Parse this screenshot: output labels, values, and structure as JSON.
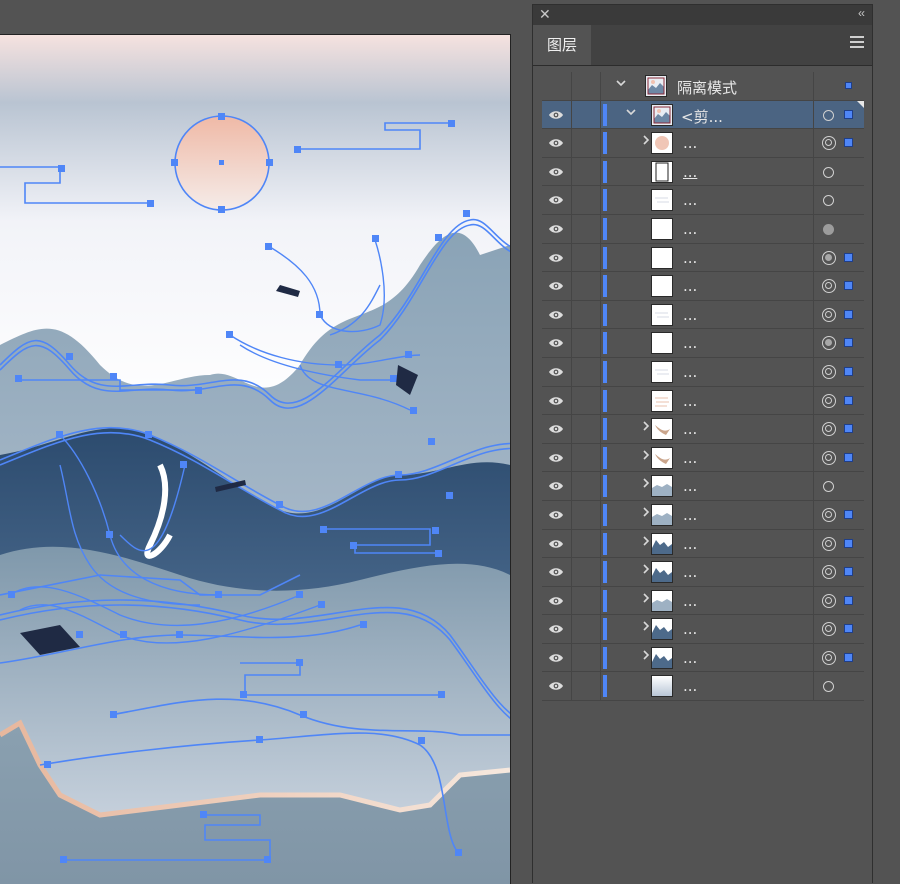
{
  "panel": {
    "close_glyph": "✕",
    "collapse_glyph": "‹‹",
    "tab_label": "图层",
    "menu_icon": "hamburger-menu-icon"
  },
  "layers": [
    {
      "name": "隔离模式",
      "indent": 0,
      "expand": "open",
      "thumb": "artwork",
      "target": "none",
      "sel": "small",
      "selected": false,
      "eye": false,
      "bar": false
    },
    {
      "name": "<剪...",
      "indent": 1,
      "expand": "open",
      "thumb": "artwork",
      "target": "open",
      "sel": "square",
      "selected": true,
      "eye": true,
      "bar": true
    },
    {
      "name": "...",
      "indent": 2,
      "expand": "closed",
      "thumb": "sun",
      "target": "double",
      "sel": "square",
      "selected": false,
      "eye": true,
      "bar": true
    },
    {
      "name": "...",
      "indent": 2,
      "expand": "none",
      "thumb": "frame",
      "target": "open",
      "sel": "none",
      "selected": false,
      "eye": true,
      "bar": true,
      "underline": true
    },
    {
      "name": "...",
      "indent": 2,
      "expand": "none",
      "thumb": "lines",
      "target": "open",
      "sel": "none",
      "selected": false,
      "eye": true,
      "bar": true
    },
    {
      "name": "...",
      "indent": 2,
      "expand": "none",
      "thumb": "blank",
      "target": "filled",
      "sel": "none",
      "selected": false,
      "eye": true,
      "bar": true
    },
    {
      "name": "...",
      "indent": 2,
      "expand": "none",
      "thumb": "blank",
      "target": "doublefill",
      "sel": "square",
      "selected": false,
      "eye": true,
      "bar": true
    },
    {
      "name": "...",
      "indent": 2,
      "expand": "none",
      "thumb": "blank",
      "target": "double",
      "sel": "square",
      "selected": false,
      "eye": true,
      "bar": true
    },
    {
      "name": "...",
      "indent": 2,
      "expand": "none",
      "thumb": "lines",
      "target": "double",
      "sel": "square",
      "selected": false,
      "eye": true,
      "bar": true
    },
    {
      "name": "...",
      "indent": 2,
      "expand": "none",
      "thumb": "blank",
      "target": "doublefill",
      "sel": "square",
      "selected": false,
      "eye": true,
      "bar": true
    },
    {
      "name": "...",
      "indent": 2,
      "expand": "none",
      "thumb": "lines",
      "target": "double",
      "sel": "square",
      "selected": false,
      "eye": true,
      "bar": true
    },
    {
      "name": "...",
      "indent": 2,
      "expand": "none",
      "thumb": "lines-peach",
      "target": "double",
      "sel": "square",
      "selected": false,
      "eye": true,
      "bar": true
    },
    {
      "name": "...",
      "indent": 2,
      "expand": "closed",
      "thumb": "crane",
      "target": "double",
      "sel": "square",
      "selected": false,
      "eye": true,
      "bar": true
    },
    {
      "name": "...",
      "indent": 2,
      "expand": "closed",
      "thumb": "crane",
      "target": "double",
      "sel": "square",
      "selected": false,
      "eye": true,
      "bar": true
    },
    {
      "name": "...",
      "indent": 2,
      "expand": "closed",
      "thumb": "mountain-light",
      "target": "open",
      "sel": "none",
      "selected": false,
      "eye": true,
      "bar": true
    },
    {
      "name": "...",
      "indent": 2,
      "expand": "closed",
      "thumb": "mountain-light",
      "target": "double",
      "sel": "square",
      "selected": false,
      "eye": true,
      "bar": true
    },
    {
      "name": "...",
      "indent": 2,
      "expand": "closed",
      "thumb": "mountain-dark",
      "target": "double",
      "sel": "square",
      "selected": false,
      "eye": true,
      "bar": true
    },
    {
      "name": "...",
      "indent": 2,
      "expand": "closed",
      "thumb": "mountain-dark",
      "target": "double",
      "sel": "square",
      "selected": false,
      "eye": true,
      "bar": true
    },
    {
      "name": "...",
      "indent": 2,
      "expand": "closed",
      "thumb": "mountain-light",
      "target": "double",
      "sel": "square",
      "selected": false,
      "eye": true,
      "bar": true
    },
    {
      "name": "...",
      "indent": 2,
      "expand": "closed",
      "thumb": "mountain-dark",
      "target": "double",
      "sel": "square",
      "selected": false,
      "eye": true,
      "bar": true
    },
    {
      "name": "...",
      "indent": 2,
      "expand": "closed",
      "thumb": "mountain-dark",
      "target": "double",
      "sel": "square",
      "selected": false,
      "eye": true,
      "bar": true
    },
    {
      "name": "...",
      "indent": 2,
      "expand": "none",
      "thumb": "gradient",
      "target": "open",
      "sel": "none",
      "selected": false,
      "eye": true,
      "bar": true
    }
  ],
  "colors": {
    "selection_blue": "#4f86f7",
    "selected_row": "#4b6482",
    "panel_bg": "#535353"
  }
}
